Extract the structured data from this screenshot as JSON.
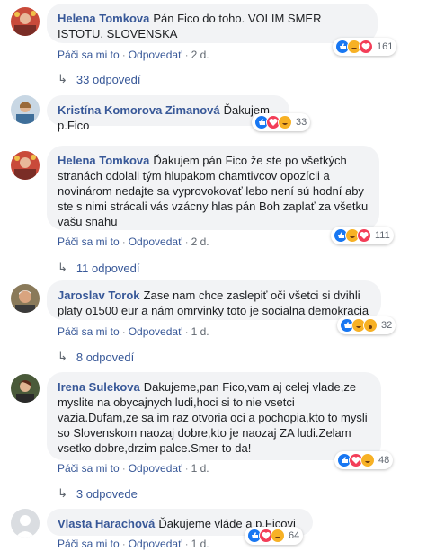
{
  "comments": [
    {
      "author": "Helena Tomkova",
      "text": "Pán Fico do toho. VOLIM SMER ISTOTU. SLOVENSKA",
      "like_label": "Páči sa mi to",
      "reply_label": "Odpovedať",
      "time": "2 d.",
      "reaction_count": "161",
      "replies_label": "33 odpovedí"
    },
    {
      "author": "Kristína Komorova Zimanová",
      "text": "Ďakujem p.Fico",
      "reaction_count": "33"
    },
    {
      "author": "Helena Tomkova",
      "text": "Ďakujem pán Fico že ste po všetkých stranách odolali tým hlupakom chamtivcov opozícii a novinárom nedajte sa vyprovokovať lebo není sú hodní aby ste s nimi strácali vás vzácny hlas pán Boh zaplať za všetku vašu snahu",
      "like_label": "Páči sa mi to",
      "reply_label": "Odpovedať",
      "time": "2 d.",
      "reaction_count": "111",
      "replies_label": "11 odpovedí"
    },
    {
      "author": "Jaroslav Torok",
      "text": "Zase nam chce zaslepiť oči všetci si dvihli platy o1500 eur a nám omrvinky toto je socialna demokracia",
      "like_label": "Páči sa mi to",
      "reply_label": "Odpovedať",
      "time": "1 d.",
      "reaction_count": "32",
      "replies_label": "8 odpovedí"
    },
    {
      "author": "Irena Sulekova",
      "text": "Dakujeme,pan Fico,vam aj celej vlade,ze myslite na obycajnych ludi,hoci si to nie vsetci vazia.Dufam,ze sa im raz otvoria oci a pochopia,kto to mysli so Slovenskom naozaj dobre,kto je naozaj ZA ludi.Zelam vsetko dobre,drzim palce.Smer to da!",
      "like_label": "Páči sa mi to",
      "reply_label": "Odpovedať",
      "time": "1 d.",
      "reaction_count": "48",
      "replies_label": "3 odpovede"
    },
    {
      "author": "Vlasta Harachová",
      "text": "Ďakujeme vláde a p.Ficovi",
      "like_label": "Páči sa mi to",
      "reply_label": "Odpovedať",
      "time": "1 d.",
      "reaction_count": "64"
    }
  ],
  "colors": {
    "link": "#385898",
    "bubble": "#f2f3f5",
    "meta": "#606770",
    "like": "#1877f2",
    "love": "#f33e58",
    "haha": "#f7b125"
  }
}
